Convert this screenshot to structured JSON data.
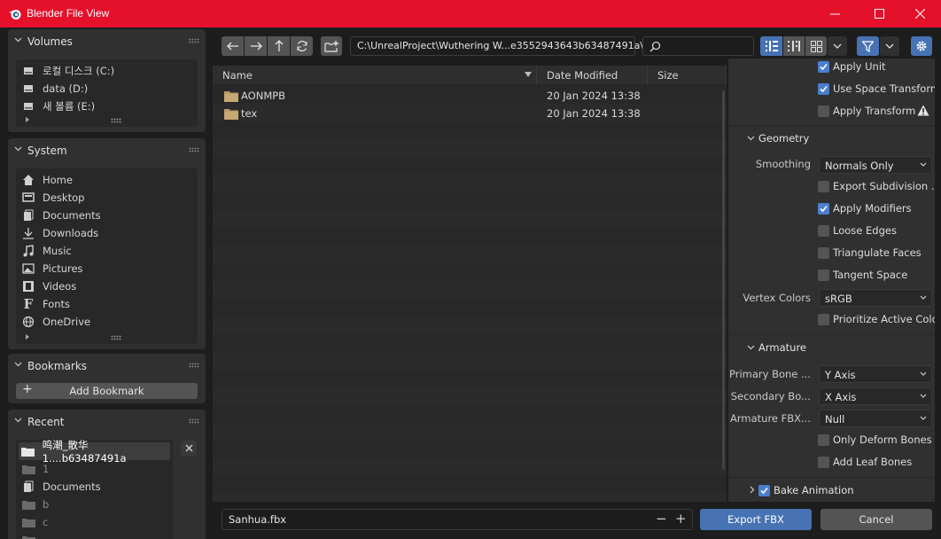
{
  "window": {
    "title": "Blender File View"
  },
  "volumes": {
    "title": "Volumes",
    "items": [
      "로컬 디스크 (C:)",
      "data (D:)",
      "새 볼륨 (E:)"
    ]
  },
  "system": {
    "title": "System",
    "items": [
      "Home",
      "Desktop",
      "Documents",
      "Downloads",
      "Music",
      "Pictures",
      "Videos",
      "Fonts",
      "OneDrive"
    ]
  },
  "bookmarks": {
    "title": "Bookmarks",
    "add_label": "Add Bookmark"
  },
  "recent": {
    "title": "Recent",
    "items": [
      "鸣潮_散华1....b63487491a",
      "1",
      "Documents",
      "b",
      "c"
    ]
  },
  "toolbar": {
    "path": "C:\\UnrealProject\\Wuthering W...e3552943643b63487491a\\"
  },
  "columns": {
    "name": "Name",
    "date": "Date Modified",
    "size": "Size"
  },
  "files": [
    {
      "name": "AONMPB",
      "date": "20 Jan 2024 13:38"
    },
    {
      "name": "tex",
      "date": "20 Jan 2024 13:38"
    }
  ],
  "props": {
    "apply_unit": "Apply Unit",
    "use_space_transform": "Use Space Transform",
    "apply_transform": "Apply Transform",
    "geometry": "Geometry",
    "smoothing_label": "Smoothing",
    "smoothing_value": "Normals Only",
    "export_subdivision": "Export Subdivision ...",
    "apply_modifiers": "Apply Modifiers",
    "loose_edges": "Loose Edges",
    "triangulate": "Triangulate Faces",
    "tangent": "Tangent Space",
    "vertex_colors_label": "Vertex Colors",
    "vertex_colors_value": "sRGB",
    "prioritize": "Prioritize Active Color",
    "armature": "Armature",
    "primary_label": "Primary Bone ...",
    "primary_value": "Y Axis",
    "secondary_label": "Secondary Bo...",
    "secondary_value": "X Axis",
    "armfbx_label": "Armature FBX...",
    "armfbx_value": "Null",
    "only_deform": "Only Deform Bones",
    "add_leaf": "Add Leaf Bones",
    "bake_animation": "Bake Animation"
  },
  "footer": {
    "filename": "Sanhua.fbx",
    "export_label": "Export FBX",
    "cancel_label": "Cancel"
  },
  "colors": {
    "titlebar": "#e5102a",
    "accent": "#4772b3",
    "checkbox_on": "#4a7fd0"
  }
}
